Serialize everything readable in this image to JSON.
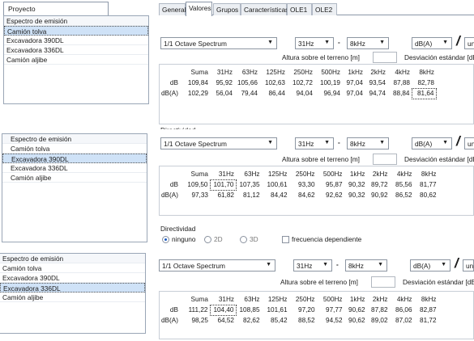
{
  "left": {
    "tab_label": "Proyecto",
    "panels": [
      {
        "items": [
          "Espectro de emisión",
          "Camión tolva",
          "Excavadora 390DL",
          "Excavadora 336DL",
          "Camión aljibe"
        ],
        "selected": 1
      },
      {
        "items": [
          "Espectro de emisión",
          "Camión tolva",
          "Excavadora 390DL",
          "Excavadora 336DL",
          "Camión aljibe"
        ],
        "selected": 2
      },
      {
        "items": [
          "Espectro de emisión",
          "Camión tolva",
          "Excavadora 390DL",
          "Excavadora 336DL",
          "Camión aljibe"
        ],
        "selected": 3
      }
    ]
  },
  "tabs": [
    "General",
    "Valores",
    "Grupos",
    "Características",
    "OLE1",
    "OLE2"
  ],
  "active_tab": "Valores",
  "controls": {
    "spectrum": "1/1 Octave Spectrum",
    "from": "31Hz",
    "dash": "-",
    "to": "8kHz",
    "weighting": "dB(A)",
    "slash": "/",
    "unit_short": "uni",
    "unit_long": "unid",
    "altura": "Altura sobre el terreno [m]",
    "desviacion": "Desviación estándar [dB]",
    "directividad": "Directividad",
    "radio_ninguno": "ninguno",
    "radio_2d": "2D",
    "radio_3d": "3D",
    "frecuencia": "frecuencia dependiente"
  },
  "columns": [
    "Suma",
    "31Hz",
    "63Hz",
    "125Hz",
    "250Hz",
    "500Hz",
    "1kHz",
    "2kHz",
    "4kHz",
    "8kHz"
  ],
  "blocks": [
    {
      "rows": [
        {
          "label": "dB",
          "values": [
            "109,84",
            "95,92",
            "105,66",
            "102,63",
            "102,72",
            "100,19",
            "97,04",
            "93,54",
            "87,88",
            "82,78"
          ]
        },
        {
          "label": "dB(A)",
          "values": [
            "102,29",
            "56,04",
            "79,44",
            "86,44",
            "94,04",
            "96,94",
            "97,04",
            "94,74",
            "88,84",
            "81,64"
          ]
        }
      ]
    },
    {
      "rows": [
        {
          "label": "dB",
          "values": [
            "109,50",
            "101,70",
            "107,35",
            "100,61",
            "93,30",
            "95,87",
            "90,32",
            "89,72",
            "85,56",
            "81,77"
          ]
        },
        {
          "label": "dB(A)",
          "values": [
            "97,33",
            "61,82",
            "81,12",
            "84,42",
            "84,62",
            "92,62",
            "90,32",
            "90,92",
            "86,52",
            "80,62"
          ]
        }
      ]
    },
    {
      "rows": [
        {
          "label": "dB",
          "values": [
            "111,22",
            "104,40",
            "108,85",
            "101,61",
            "97,20",
            "97,77",
            "90,62",
            "87,82",
            "86,06",
            "82,87"
          ]
        },
        {
          "label": "dB(A)",
          "values": [
            "98,25",
            "64,52",
            "82,62",
            "85,42",
            "88,52",
            "94,52",
            "90,62",
            "89,02",
            "87,02",
            "81,72"
          ]
        }
      ]
    }
  ]
}
